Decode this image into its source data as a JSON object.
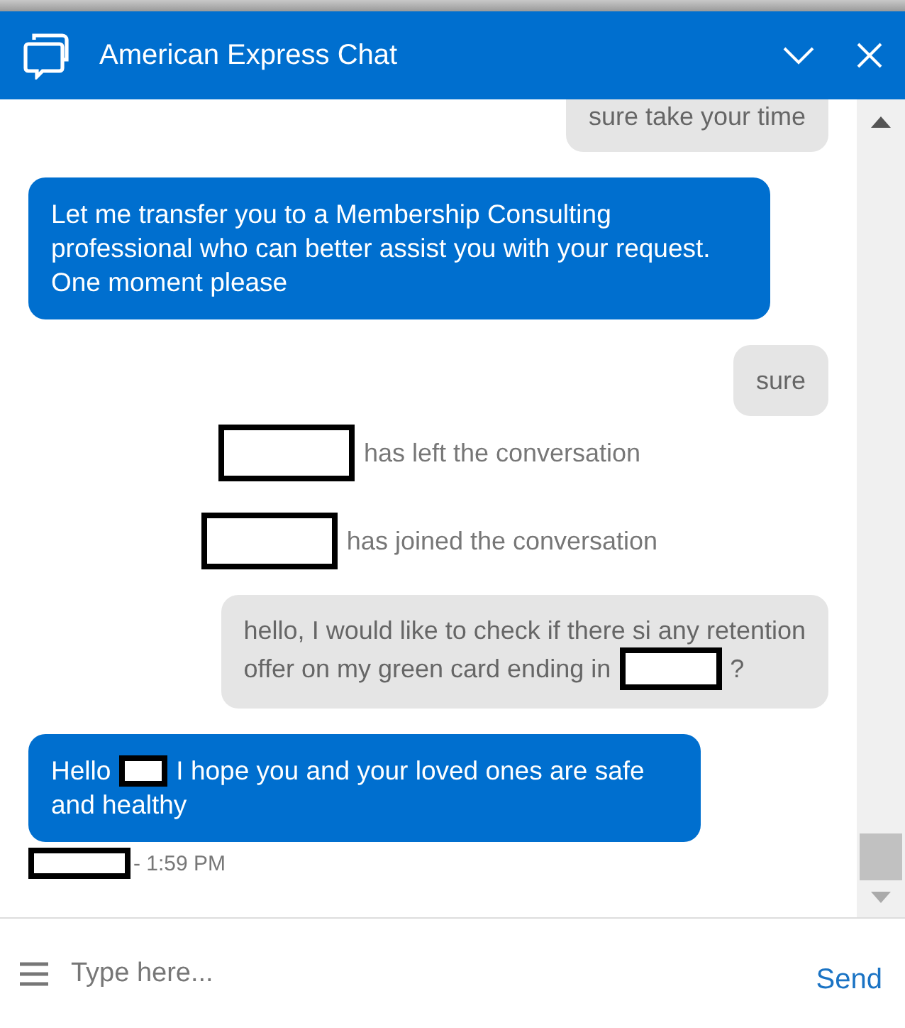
{
  "window": {
    "title": "American Express Chat"
  },
  "messages": [
    {
      "kind": "user",
      "lines": [
        [
          {
            "kind": "text",
            "text": "sure take your time"
          }
        ]
      ]
    },
    {
      "kind": "agent",
      "lines": [
        [
          {
            "kind": "text",
            "text": "Let me transfer you to a Membership Consulting professional who can better assist you with your request. One moment please"
          }
        ]
      ]
    },
    {
      "kind": "user",
      "lines": [
        [
          {
            "kind": "text",
            "text": "sure"
          }
        ]
      ]
    },
    {
      "kind": "system",
      "lines": [
        [
          {
            "kind": "redaction"
          },
          {
            "kind": "text",
            "text": "has left the conversation"
          }
        ]
      ]
    },
    {
      "kind": "system",
      "lines": [
        [
          {
            "kind": "redaction"
          },
          {
            "kind": "text",
            "text": "has joined the conversation"
          }
        ]
      ]
    },
    {
      "kind": "user",
      "lines": [
        [
          {
            "kind": "text",
            "text": "hello, I would like to check if there si any retention"
          }
        ],
        [
          {
            "kind": "text",
            "text": "offer on my green card ending in"
          },
          {
            "kind": "redaction"
          },
          {
            "kind": "text",
            "text": "?"
          }
        ]
      ]
    },
    {
      "kind": "agent",
      "lines": [
        [
          {
            "kind": "text",
            "text": "Hello"
          },
          {
            "kind": "redaction"
          },
          {
            "kind": "text",
            "text": "I hope you and your loved ones are safe"
          }
        ],
        [
          {
            "kind": "text",
            "text": "and healthy"
          }
        ]
      ]
    }
  ],
  "timestamp": {
    "parts": [
      {
        "kind": "redaction"
      },
      {
        "kind": "text",
        "text": "- 1:59 PM"
      }
    ]
  },
  "composer": {
    "placeholder": "Type here...",
    "send": "Send"
  }
}
